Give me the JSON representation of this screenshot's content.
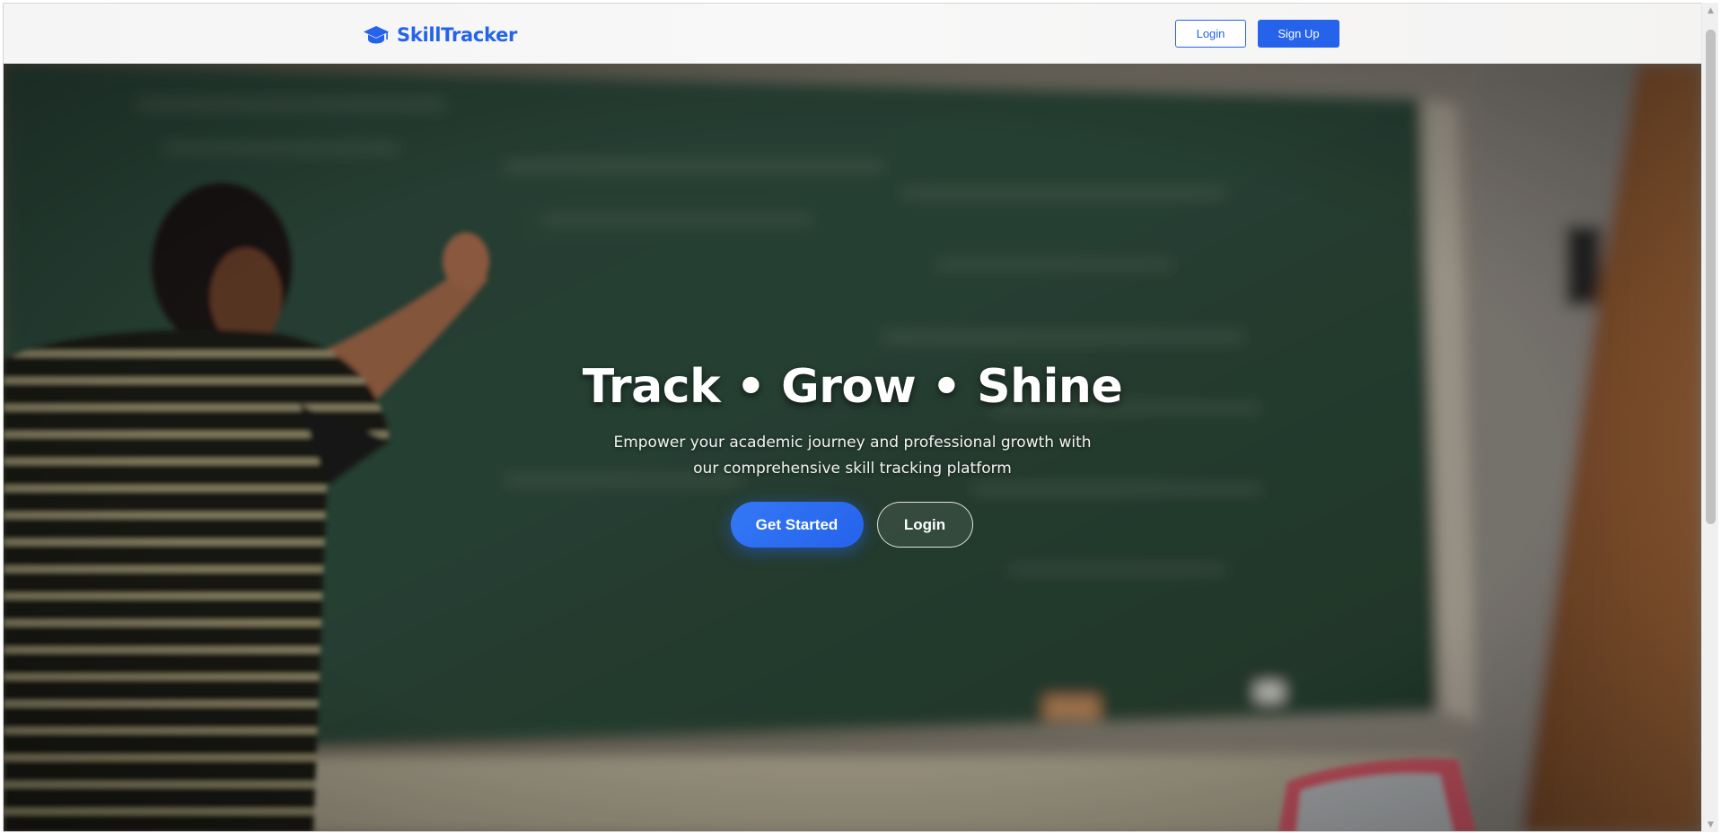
{
  "navbar": {
    "brand_name": "SkillTracker",
    "brand_icon": "graduation-cap-icon",
    "login_label": "Login",
    "signup_label": "Sign Up"
  },
  "hero": {
    "title": "Track • Grow • Shine",
    "subtitle": "Empower your academic journey and professional growth with our comprehensive skill tracking platform",
    "primary_cta_label": "Get Started",
    "secondary_cta_label": "Login",
    "background": "photo of a teacher writing on a chalkboard"
  },
  "colors": {
    "accent": "#2563eb",
    "text_on_hero": "#ffffff"
  },
  "scrollbar": {
    "up_icon": "▲",
    "down_icon": "▼"
  }
}
